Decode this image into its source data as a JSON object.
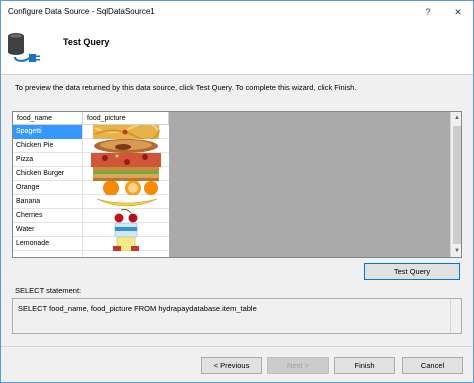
{
  "window": {
    "title": "Configure Data Source - SqlDataSource1"
  },
  "titlebar_buttons": {
    "help": "?",
    "close": "✕"
  },
  "header": {
    "title": "Test Query",
    "icon": "database-connect-icon"
  },
  "instructions": "To preview the data returned by this data source, click Test Query. To complete this wizard, click Finish.",
  "grid": {
    "columns": [
      "food_name",
      "food_picture"
    ],
    "rows": [
      {
        "name": "Spagetti",
        "selected": true
      },
      {
        "name": "Chicken Pie",
        "selected": false
      },
      {
        "name": "Pizza",
        "selected": false
      },
      {
        "name": "Chicken Burger",
        "selected": false
      },
      {
        "name": "Orange",
        "selected": false
      },
      {
        "name": "Banana",
        "selected": false
      },
      {
        "name": "Cherries",
        "selected": false
      },
      {
        "name": "Water",
        "selected": false
      },
      {
        "name": "Lemonade",
        "selected": false
      }
    ]
  },
  "buttons": {
    "test_query": "Test Query",
    "previous": "< Previous",
    "next": "Next >",
    "finish": "Finish",
    "cancel": "Cancel"
  },
  "select_statement": {
    "label": "SELECT statement:",
    "sql": "SELECT food_name, food_picture FROM hydrapaydatabase.item_table"
  },
  "colors": {
    "selection": "#3399ff",
    "grid_background": "#aaaaaa",
    "focus_border": "#0078d7"
  }
}
